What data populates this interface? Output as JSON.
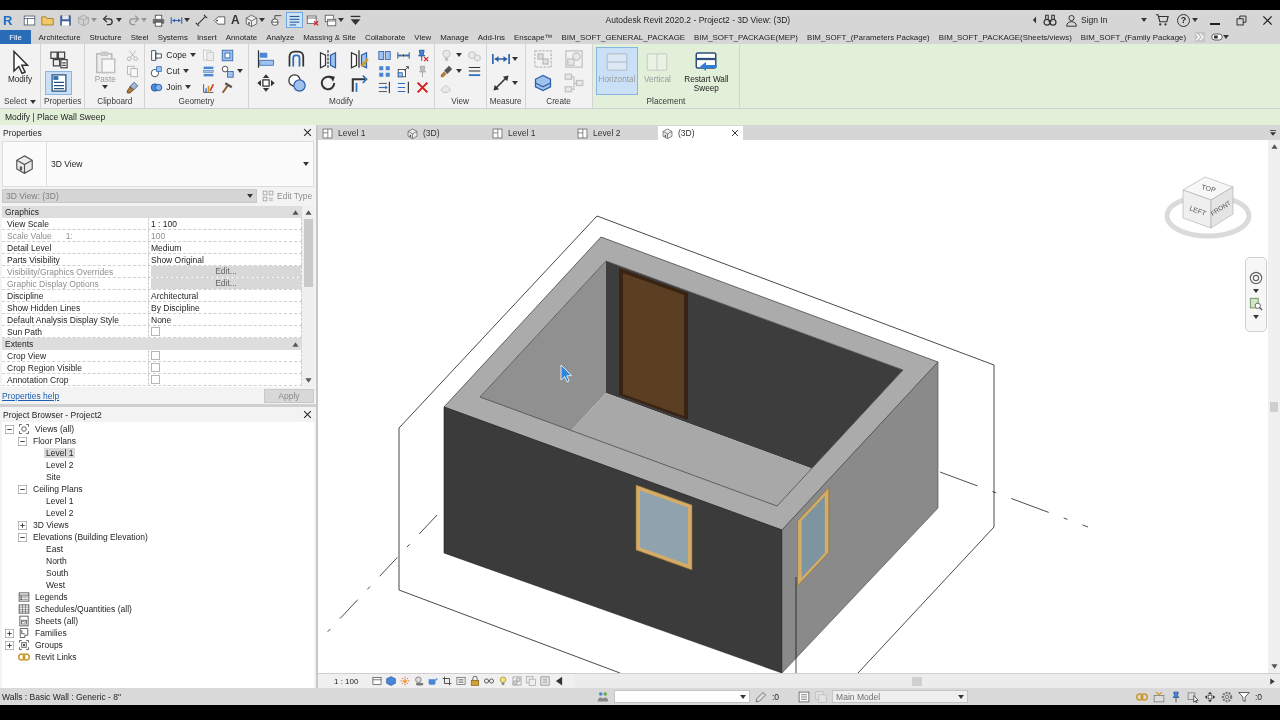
{
  "window": {
    "logo": "R",
    "title": "Autodesk Revit 2020.2 - Project2 - 3D View: (3D)",
    "sign_in": "Sign In",
    "help": "?"
  },
  "quick_access": [
    {
      "kind": "grid-window",
      "menu": false,
      "disabled": false,
      "on": false
    },
    {
      "kind": "folder",
      "menu": false,
      "disabled": false,
      "on": false
    },
    {
      "kind": "floppy-disk",
      "menu": false,
      "disabled": false,
      "on": false
    },
    {
      "kind": "cube",
      "menu": true,
      "disabled": true,
      "on": false
    },
    {
      "kind": "undo-arrow",
      "menu": true,
      "disabled": false,
      "on": false
    },
    {
      "kind": "redo-arrow",
      "menu": true,
      "disabled": true,
      "on": false
    },
    {
      "kind": "printer",
      "menu": false,
      "disabled": false,
      "on": false
    },
    {
      "kind": "double-arrow",
      "menu": true,
      "disabled": false,
      "on": false
    },
    {
      "kind": "dimension-line",
      "menu": false,
      "disabled": false,
      "on": false
    },
    {
      "kind": "tag",
      "menu": false,
      "disabled": false,
      "on": false
    },
    {
      "kind": "glyph",
      "glyph": "A",
      "menu": false,
      "disabled": false,
      "on": false
    },
    {
      "kind": "house",
      "menu": true,
      "disabled": false,
      "on": false
    },
    {
      "kind": "section-marker",
      "menu": false,
      "disabled": false,
      "on": false
    },
    {
      "kind": "thin-lines",
      "menu": false,
      "disabled": false,
      "on": true
    },
    {
      "kind": "window-close",
      "menu": false,
      "disabled": false,
      "on": false
    },
    {
      "kind": "windows-stack",
      "menu": true,
      "disabled": false,
      "on": false
    },
    {
      "kind": "bar-caret",
      "menu": false,
      "disabled": false,
      "on": false
    }
  ],
  "ribbon_tabs": [
    {
      "label": "File",
      "kind": "application",
      "selected": false
    },
    {
      "label": "Architecture",
      "kind": "tab",
      "selected": false
    },
    {
      "label": "Structure",
      "kind": "tab",
      "selected": false
    },
    {
      "label": "Steel",
      "kind": "tab",
      "selected": false
    },
    {
      "label": "Systems",
      "kind": "tab",
      "selected": false
    },
    {
      "label": "Insert",
      "kind": "tab",
      "selected": false
    },
    {
      "label": "Annotate",
      "kind": "tab",
      "selected": false
    },
    {
      "label": "Analyze",
      "kind": "tab",
      "selected": false
    },
    {
      "label": "Massing & Site",
      "kind": "tab",
      "selected": false
    },
    {
      "label": "Collaborate",
      "kind": "tab",
      "selected": false
    },
    {
      "label": "View",
      "kind": "tab",
      "selected": false
    },
    {
      "label": "Manage",
      "kind": "tab",
      "selected": false
    },
    {
      "label": "Add-Ins",
      "kind": "tab",
      "selected": false
    },
    {
      "label": "Enscape™",
      "kind": "tab",
      "selected": false
    },
    {
      "label": "BIM_SOFT_GENERAL_PACKAGE",
      "kind": "tab",
      "selected": false
    },
    {
      "label": "BIM_SOFT_PACKAGE(MEP)",
      "kind": "tab",
      "selected": false
    },
    {
      "label": "BIM_SOFT_(Parameters Package)",
      "kind": "tab",
      "selected": false
    },
    {
      "label": "BIM_SOFT_PACKAGE(Sheets/views)",
      "kind": "tab",
      "selected": false
    },
    {
      "label": "BIM_SOFT_(Family Package)",
      "kind": "tab",
      "selected": false
    }
  ],
  "ribbon_panels": [
    {
      "label": "Select",
      "menu": true,
      "contextual": false,
      "columns": [
        {
          "kind": "large",
          "tools": [
            {
              "kind": "cursor",
              "label": "Modify",
              "menu": false,
              "disabled": false,
              "on": false
            }
          ]
        }
      ]
    },
    {
      "label": "Properties",
      "menu": false,
      "contextual": false,
      "columns": [
        {
          "kind": "medium",
          "tools": [
            {
              "kind": "cube-stack",
              "menu": false,
              "disabled": false,
              "on": false
            },
            {
              "kind": "property-sheet",
              "menu": false,
              "disabled": false,
              "on": true
            }
          ]
        }
      ]
    },
    {
      "label": "Clipboard",
      "menu": false,
      "contextual": false,
      "columns": [
        {
          "kind": "large",
          "tools": [
            {
              "kind": "clipboard",
              "label": "Paste",
              "menu": true,
              "disabled": true,
              "on": false
            }
          ]
        },
        {
          "kind": "small",
          "tools": [
            {
              "kind": "scissors",
              "menu": false,
              "disabled": true,
              "on": false
            },
            {
              "kind": "pages",
              "menu": false,
              "disabled": true,
              "on": false
            },
            {
              "kind": "paintbrush",
              "menu": false,
              "disabled": false,
              "on": false
            }
          ]
        }
      ]
    },
    {
      "label": "Geometry",
      "menu": false,
      "contextual": false,
      "columns": [
        {
          "kind": "small",
          "tools": [
            {
              "kind": "notched-beam",
              "label": "Cope",
              "menu": true,
              "disabled": false,
              "on": false
            },
            {
              "kind": "cut-sphere",
              "label": "Cut",
              "menu": true,
              "disabled": false,
              "on": false
            },
            {
              "kind": "join-spheres",
              "label": "Join",
              "menu": true,
              "disabled": false,
              "on": false
            }
          ]
        },
        {
          "kind": "small",
          "tools": [
            {
              "kind": "split-page",
              "menu": false,
              "disabled": true,
              "on": false
            },
            {
              "kind": "stacked-bars",
              "menu": false,
              "disabled": false,
              "on": false
            },
            {
              "kind": "bar-chart",
              "menu": false,
              "disabled": false,
              "on": false
            }
          ]
        },
        {
          "kind": "small",
          "tools": [
            {
              "kind": "framed-square",
              "menu": false,
              "disabled": false,
              "on": false
            },
            {
              "kind": "circle-square",
              "menu": true,
              "disabled": false,
              "on": false
            },
            {
              "kind": "hammer",
              "menu": false,
              "disabled": false,
              "on": false
            }
          ]
        }
      ]
    },
    {
      "label": "Modify",
      "menu": false,
      "contextual": false,
      "columns": [
        {
          "kind": "medium",
          "tools": [
            {
              "kind": "align-bars",
              "menu": false,
              "disabled": false,
              "on": false
            },
            {
              "kind": "move-arrows",
              "menu": false,
              "disabled": false,
              "on": false
            }
          ]
        },
        {
          "kind": "medium",
          "tools": [
            {
              "kind": "offset-curve",
              "menu": false,
              "disabled": false,
              "on": false
            },
            {
              "kind": "copy-circles",
              "menu": false,
              "disabled": false,
              "on": false
            }
          ]
        },
        {
          "kind": "medium",
          "tools": [
            {
              "kind": "mirror-pick",
              "menu": false,
              "disabled": false,
              "on": false
            },
            {
              "kind": "rotate-circle",
              "menu": false,
              "disabled": false,
              "on": false
            }
          ]
        },
        {
          "kind": "medium",
          "tools": [
            {
              "kind": "mirror-draw",
              "menu": false,
              "disabled": false,
              "on": false
            },
            {
              "kind": "trim-corner",
              "menu": false,
              "disabled": false,
              "on": false
            }
          ]
        },
        {
          "kind": "small",
          "tools": [
            {
              "kind": "split-bars",
              "menu": false,
              "disabled": false,
              "on": false
            },
            {
              "kind": "grid-array",
              "menu": false,
              "disabled": false,
              "on": false
            },
            {
              "kind": "arrow-lines",
              "menu": false,
              "disabled": false,
              "on": false
            }
          ]
        },
        {
          "kind": "small",
          "tools": [
            {
              "kind": "split-gap",
              "menu": false,
              "disabled": false,
              "on": false
            },
            {
              "kind": "scale-square",
              "menu": false,
              "disabled": false,
              "on": false
            },
            {
              "kind": "extend-lines",
              "menu": false,
              "disabled": false,
              "on": false
            }
          ]
        },
        {
          "kind": "small",
          "tools": [
            {
              "kind": "pin-cross",
              "menu": false,
              "disabled": false,
              "on": false
            },
            {
              "kind": "pin",
              "menu": false,
              "disabled": true,
              "on": false
            },
            {
              "kind": "cross-mark",
              "menu": false,
              "disabled": false,
              "on": false
            }
          ]
        }
      ]
    },
    {
      "label": "View",
      "menu": false,
      "contextual": false,
      "columns": [
        {
          "kind": "small",
          "tools": [
            {
              "kind": "bulb",
              "menu": true,
              "disabled": true,
              "on": false
            },
            {
              "kind": "brush-stroke",
              "menu": true,
              "disabled": false,
              "on": false
            },
            {
              "kind": "pentagon",
              "menu": false,
              "disabled": true,
              "on": false
            }
          ]
        },
        {
          "kind": "small",
          "tools": [
            {
              "kind": "cube-pair",
              "menu": false,
              "disabled": true,
              "on": false
            },
            {
              "kind": "linework",
              "menu": false,
              "disabled": false,
              "on": false
            }
          ]
        }
      ]
    },
    {
      "label": "Measure",
      "menu": false,
      "contextual": false,
      "columns": [
        {
          "kind": "medium",
          "tools": [
            {
              "kind": "double-arrow",
              "menu": true,
              "disabled": false,
              "on": false
            },
            {
              "kind": "diagonal-dimension",
              "menu": true,
              "disabled": false,
              "on": false
            }
          ]
        }
      ]
    },
    {
      "label": "Create",
      "menu": false,
      "contextual": false,
      "columns": [
        {
          "kind": "medium",
          "tools": [
            {
              "kind": "dashed-frame",
              "menu": false,
              "disabled": true,
              "on": false
            },
            {
              "kind": "layer-panels",
              "menu": false,
              "disabled": false,
              "on": false
            }
          ]
        },
        {
          "kind": "medium",
          "tools": [
            {
              "kind": "shapes-frame",
              "menu": false,
              "disabled": true,
              "on": false
            },
            {
              "kind": "node-tree",
              "menu": false,
              "disabled": true,
              "on": false
            }
          ]
        }
      ]
    },
    {
      "label": "Placement",
      "menu": false,
      "contextual": true,
      "columns": [
        {
          "kind": "large",
          "tools": [
            {
              "kind": "horizontal-panel",
              "label": "Horizontal",
              "menu": false,
              "disabled": true,
              "on": true
            }
          ]
        },
        {
          "kind": "large",
          "tools": [
            {
              "kind": "vertical-panel",
              "label": "Vertical",
              "menu": false,
              "disabled": true,
              "on": false
            }
          ]
        },
        {
          "kind": "large",
          "tools": [
            {
              "kind": "sweep-restart",
              "label": "Restart Wall Sweep",
              "menu": false,
              "disabled": false,
              "on": false
            }
          ]
        }
      ]
    }
  ],
  "context_bar": {
    "text": "Modify | Place Wall Sweep"
  },
  "properties": {
    "title": "Properties",
    "type_name": "3D View",
    "instance": "3D View: (3D)",
    "instance_disabled": true,
    "edit_type": "Edit Type",
    "edit_type_disabled": true,
    "groups": [
      {
        "label": "Graphics",
        "expanded": true,
        "rows": [
          {
            "name": "View Scale",
            "kind": "text",
            "value": "1 : 100",
            "disabled": false
          },
          {
            "name": "Scale Value",
            "suffix": "1:",
            "kind": "text",
            "value": "100",
            "disabled": true
          },
          {
            "name": "Detail Level",
            "kind": "text",
            "value": "Medium",
            "disabled": false
          },
          {
            "name": "Parts Visibility",
            "kind": "text",
            "value": "Show Original",
            "disabled": false
          },
          {
            "name": "Visibility/Graphics Overrides",
            "kind": "button",
            "value": "Edit...",
            "disabled": true
          },
          {
            "name": "Graphic Display Options",
            "kind": "button",
            "value": "Edit...",
            "disabled": true
          },
          {
            "name": "Discipline",
            "kind": "text",
            "value": "Architectural",
            "disabled": false
          },
          {
            "name": "Show Hidden Lines",
            "kind": "text",
            "value": "By Discipline",
            "disabled": false
          },
          {
            "name": "Default Analysis Display Style",
            "kind": "text",
            "value": "None",
            "disabled": false
          },
          {
            "name": "Sun Path",
            "kind": "checkbox",
            "checked": false,
            "disabled": false
          }
        ]
      },
      {
        "label": "Extents",
        "expanded": true,
        "rows": [
          {
            "name": "Crop View",
            "kind": "checkbox",
            "checked": false,
            "disabled": false
          },
          {
            "name": "Crop Region Visible",
            "kind": "checkbox",
            "checked": false,
            "disabled": false
          },
          {
            "name": "Annotation Crop",
            "kind": "checkbox",
            "checked": false,
            "disabled": false
          }
        ]
      }
    ],
    "help": "Properties help",
    "apply": "Apply",
    "apply_disabled": true
  },
  "project_browser": {
    "title": "Project Browser - Project2",
    "items": [
      {
        "label": "Views (all)",
        "kind": "views",
        "expanded": true,
        "selected": false,
        "children": [
          {
            "label": "Floor Plans",
            "expanded": true,
            "selected": false,
            "children": [
              {
                "label": "Level 1",
                "selected": true
              },
              {
                "label": "Level 2",
                "selected": false
              },
              {
                "label": "Site",
                "selected": false
              }
            ]
          },
          {
            "label": "Ceiling Plans",
            "expanded": true,
            "selected": false,
            "children": [
              {
                "label": "Level 1",
                "selected": false
              },
              {
                "label": "Level 2",
                "selected": false
              }
            ]
          },
          {
            "label": "3D Views",
            "expanded": false,
            "selected": false
          },
          {
            "label": "Elevations (Building Elevation)",
            "expanded": true,
            "selected": false,
            "children": [
              {
                "label": "East",
                "selected": false
              },
              {
                "label": "North",
                "selected": false
              },
              {
                "label": "South",
                "selected": false
              },
              {
                "label": "West",
                "selected": false
              }
            ]
          }
        ]
      },
      {
        "label": "Legends",
        "kind": "legends",
        "selected": false
      },
      {
        "label": "Schedules/Quantities (all)",
        "kind": "schedules",
        "selected": false
      },
      {
        "label": "Sheets (all)",
        "kind": "sheets",
        "selected": false
      },
      {
        "label": "Families",
        "kind": "families",
        "expanded": false,
        "selected": false
      },
      {
        "label": "Groups",
        "kind": "groups",
        "expanded": false,
        "selected": false
      },
      {
        "label": "Revit Links",
        "kind": "links",
        "selected": false
      }
    ]
  },
  "view_tabs": [
    {
      "label": "Level 1",
      "kind": "plan",
      "selected": false
    },
    {
      "label": "(3D)",
      "kind": "isometric",
      "selected": false
    },
    {
      "label": "Level 1",
      "kind": "plan",
      "selected": false
    },
    {
      "label": "Level 2",
      "kind": "plan",
      "selected": false
    },
    {
      "label": "(3D)",
      "kind": "isometric",
      "selected": true
    }
  ],
  "view_cube": {
    "faces": [
      {
        "label": "TOP",
        "kind": "top"
      },
      {
        "label": "LEFT",
        "kind": "left"
      },
      {
        "label": "FRONT",
        "kind": "front"
      }
    ]
  },
  "view_control_bar": {
    "scale": "1 : 100"
  },
  "status_bar": {
    "selection": "Walls : Basic Wall : Generic - 8\"",
    "editable_count": ":0",
    "design_option": "Main Model",
    "design_option_disabled": true,
    "filter_count": ":0"
  }
}
